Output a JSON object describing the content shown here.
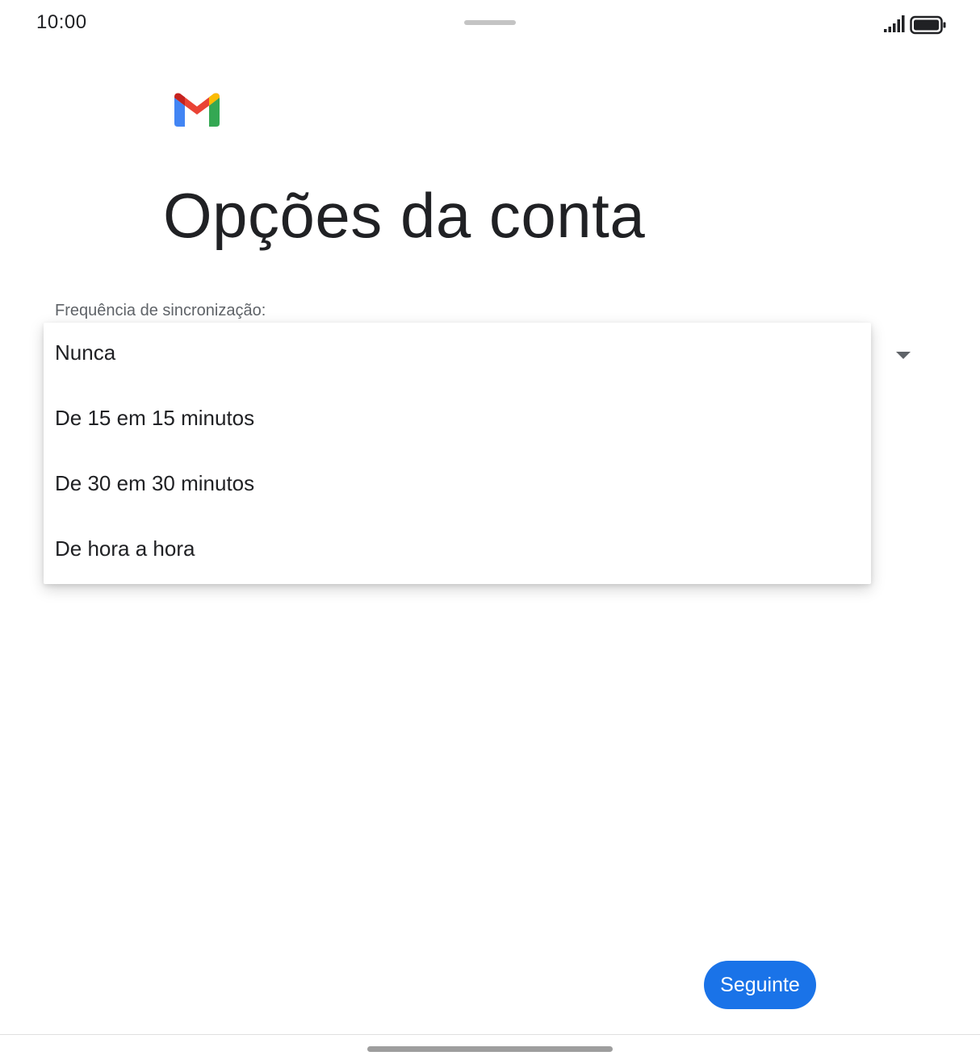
{
  "status_bar": {
    "time": "10:00",
    "signal_icon": "signal-icon",
    "battery_icon": "battery-icon"
  },
  "logo": {
    "name": "gmail-logo-icon",
    "colors": {
      "red": "#EA4335",
      "blue": "#4285F4",
      "green": "#34A853",
      "yellow": "#FBBC04",
      "dark_red": "#C5221F"
    }
  },
  "page": {
    "title": "Opções da conta"
  },
  "sync_field": {
    "label": "Frequência de sincronização:",
    "options": [
      "Nunca",
      "De 15 em 15 minutos",
      "De 30 em 30 minutos",
      "De hora a hora"
    ]
  },
  "footer": {
    "next_label": "Seguinte",
    "accent_color": "#1a73e8"
  }
}
